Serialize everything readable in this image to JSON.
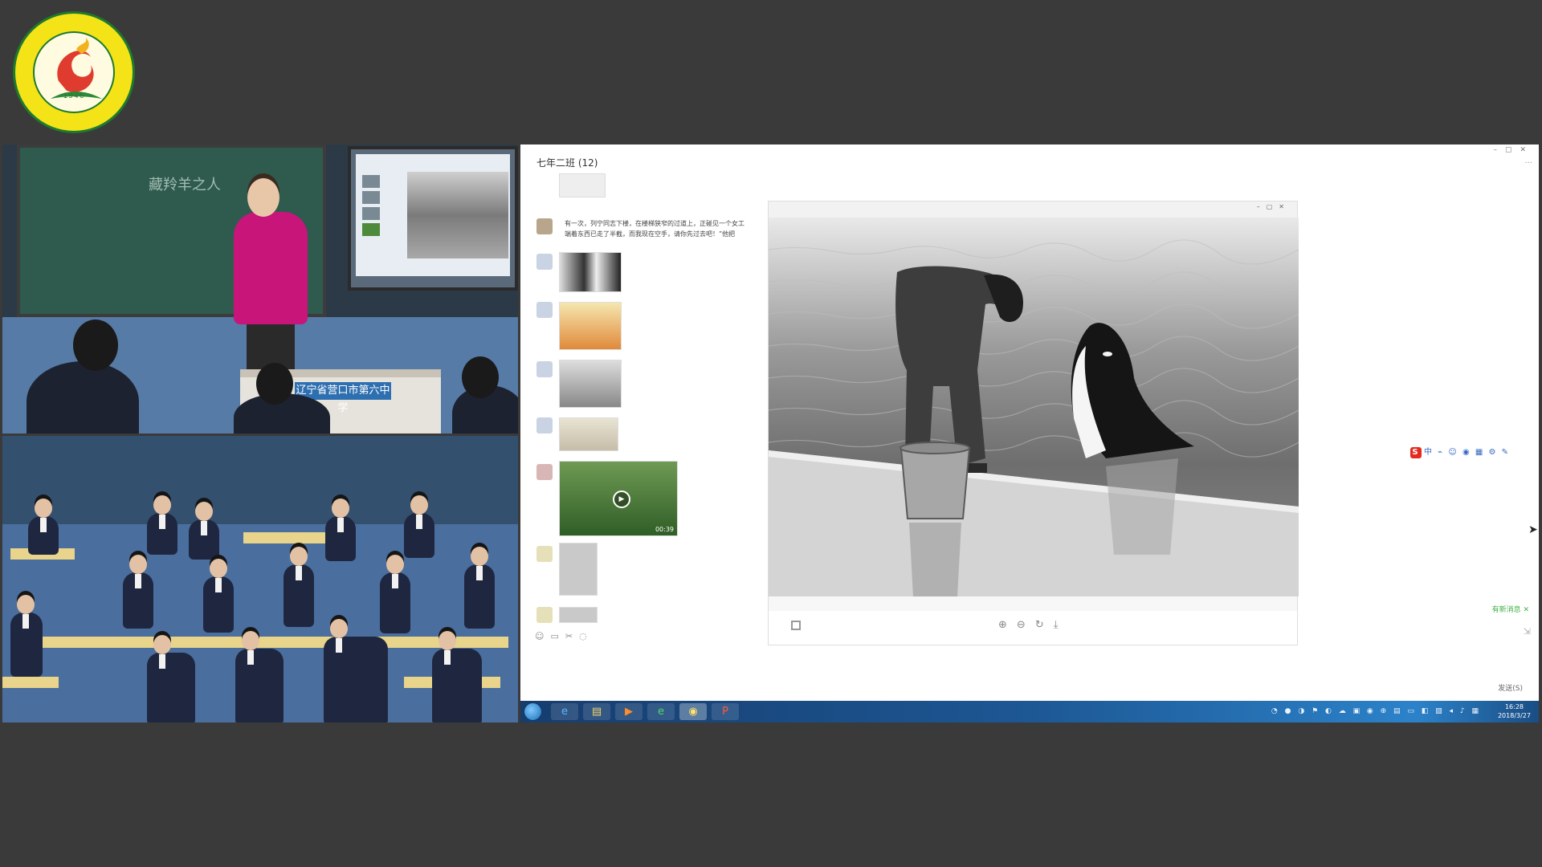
{
  "logo": {
    "year": "1946"
  },
  "classroom": {
    "board_title": "藏羚羊之人",
    "desk_sign": "辽宁省营口市第六中学"
  },
  "chat": {
    "title": "七年二班 (12)",
    "message_text": "有一次，列宁同志下楼，在楼梯狭窄的过道上，正碰见一个女工端着东西已走了半截，而我现在空手，请你先过去吧！”他把",
    "video_duration": "00:39",
    "tools": [
      "☺",
      "▭",
      "✂",
      "◌"
    ]
  },
  "viewer": {
    "controls": [
      "–",
      "▢",
      "✕"
    ],
    "zoom_in": "⊕",
    "zoom_out": "⊖",
    "rotate": "↻",
    "download": "⤓"
  },
  "ime": {
    "logo": "S",
    "mode": "中"
  },
  "notifications": {
    "new_messages": "有新消息"
  },
  "send": {
    "label": "发送(S)"
  },
  "taskbar": {
    "apps": [
      "e",
      "▤",
      "▶",
      "e",
      "◉",
      "P"
    ],
    "time": "16:28",
    "date": "2018/3/27"
  },
  "colors": {
    "accent": "#1d5794",
    "teacher": "#c8157a",
    "chalkboard": "#2f5a4e"
  }
}
